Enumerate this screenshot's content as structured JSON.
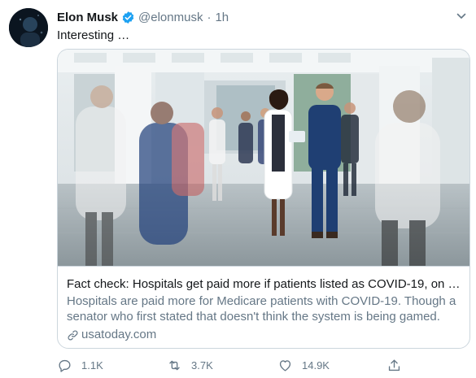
{
  "tweet": {
    "author_name": "Elon Musk",
    "handle": "@elonmusk",
    "separator": "·",
    "time": "1h",
    "text": "Interesting …",
    "verified": true
  },
  "card": {
    "title": "Fact check: Hospitals get paid more if patients listed as COVID-19, on …",
    "description": "Hospitals are paid more for Medicare patients with COVID-19. Though a senator who first stated that doesn't think the system is being gamed.",
    "domain": "usatoday.com"
  },
  "actions": {
    "replies": "1.1K",
    "retweets": "3.7K",
    "likes": "14.9K"
  },
  "colors": {
    "secondary_text": "#657786",
    "primary_text": "#14171a",
    "verified_blue": "#1da1f2",
    "border": "#ccd6dd"
  },
  "icons": [
    "verified-badge-icon",
    "caret-down-icon",
    "link-icon",
    "reply-icon",
    "retweet-icon",
    "like-icon",
    "share-icon"
  ]
}
